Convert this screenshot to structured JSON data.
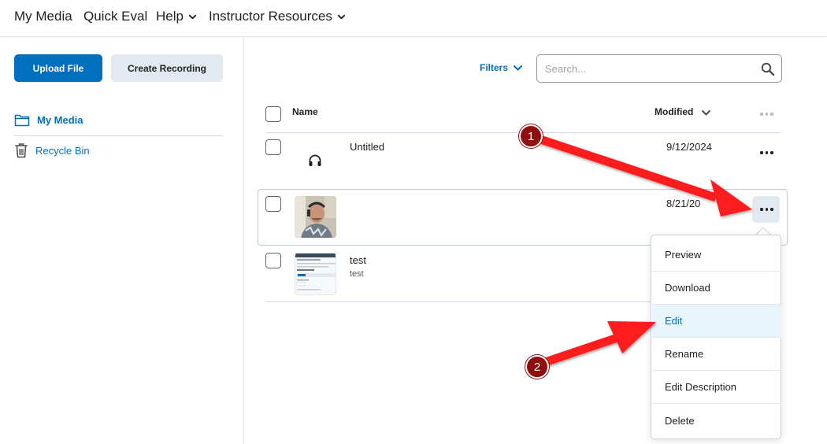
{
  "nav": {
    "items": [
      {
        "label": "My Media",
        "has_dropdown": false
      },
      {
        "label": "Quick Eval",
        "has_dropdown": false
      },
      {
        "label": "Help",
        "has_dropdown": true
      },
      {
        "label": "Instructor Resources",
        "has_dropdown": true
      }
    ]
  },
  "sidebar": {
    "upload_label": "Upload File",
    "record_label": "Create Recording",
    "links": [
      {
        "label": "My Media",
        "icon": "folder-icon",
        "active": true
      },
      {
        "label": "Recycle Bin",
        "icon": "trash-icon",
        "active": false
      }
    ]
  },
  "toolbar": {
    "filters_label": "Filters",
    "search_placeholder": "Search..."
  },
  "table": {
    "columns": {
      "name": "Name",
      "modified": "Modified"
    },
    "rows": [
      {
        "title": "Untitled",
        "subtitle": "",
        "modified": "9/12/2024",
        "thumbnail": "headphones-icon"
      },
      {
        "title": "",
        "subtitle": "",
        "modified": "8/21/20",
        "thumbnail": "person-thumbnail"
      },
      {
        "title": "test",
        "subtitle": "test",
        "modified": "",
        "thumbnail": "document-thumbnail"
      }
    ]
  },
  "context_menu": {
    "items": [
      {
        "label": "Preview"
      },
      {
        "label": "Download"
      },
      {
        "label": "Edit",
        "highlighted": true
      },
      {
        "label": "Rename"
      },
      {
        "label": "Edit Description"
      },
      {
        "label": "Delete"
      }
    ]
  },
  "annotations": {
    "markers": [
      "1",
      "2"
    ],
    "arrow_color": "#ff1a1a",
    "marker_color": "#8f0f0f"
  },
  "colors": {
    "accent": "#006fbf",
    "secondary_button": "#e3e9f1",
    "menu_highlight": "#e8f5fb"
  }
}
